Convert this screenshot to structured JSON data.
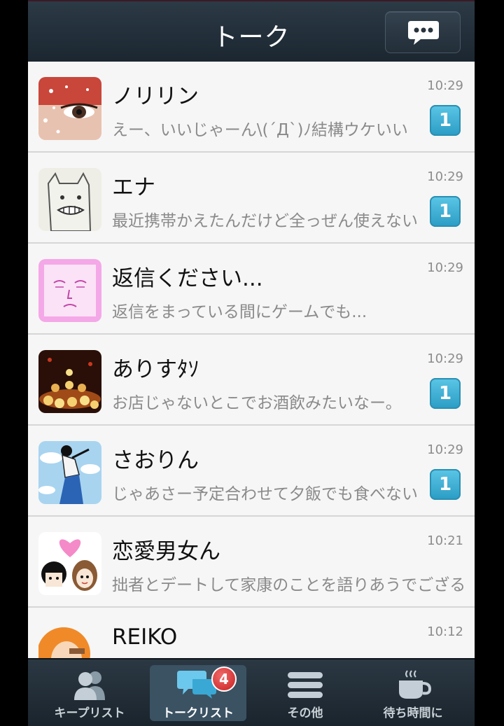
{
  "header": {
    "title": "トーク"
  },
  "chats": [
    {
      "name": "ノリリン",
      "preview": "えー、いいじゃーん\\(´Д`)ﾉ結構ウケいい",
      "time": "10:29",
      "unread": "1"
    },
    {
      "name": "エナ",
      "preview": "最近携帯かえたんだけど全っぜん使えない",
      "time": "10:29",
      "unread": "1"
    },
    {
      "name": "返信ください...",
      "preview": "返信をまっている間にゲームでも...",
      "time": "10:29",
      "unread": ""
    },
    {
      "name": "ありすﾀｿ",
      "preview": "お店じゃないとこでお酒飲みたいなー。",
      "time": "10:29",
      "unread": "1"
    },
    {
      "name": "さおりん",
      "preview": "じゃあさー予定合わせて夕飯でも食べない",
      "time": "10:29",
      "unread": "1"
    },
    {
      "name": "恋愛男女ん",
      "preview": "拙者とデートして家康のことを語りあうでござる",
      "time": "10:21",
      "unread": ""
    },
    {
      "name": "REIKO",
      "preview": "",
      "time": "10:12",
      "unread": ""
    }
  ],
  "tabbar": {
    "tabs": [
      {
        "label": "キープリスト",
        "icon": "people-icon"
      },
      {
        "label": "トークリスト",
        "icon": "chat-bubbles-icon",
        "badge": "4"
      },
      {
        "label": "その他",
        "icon": "menu-lines-icon"
      },
      {
        "label": "待ち時間に",
        "icon": "coffee-cup-icon"
      }
    ]
  },
  "colors": {
    "header": "#222e38",
    "badge": "#2a9cc4",
    "tab_badge": "#d32a2a",
    "list_bg": "#f6f6f6"
  }
}
